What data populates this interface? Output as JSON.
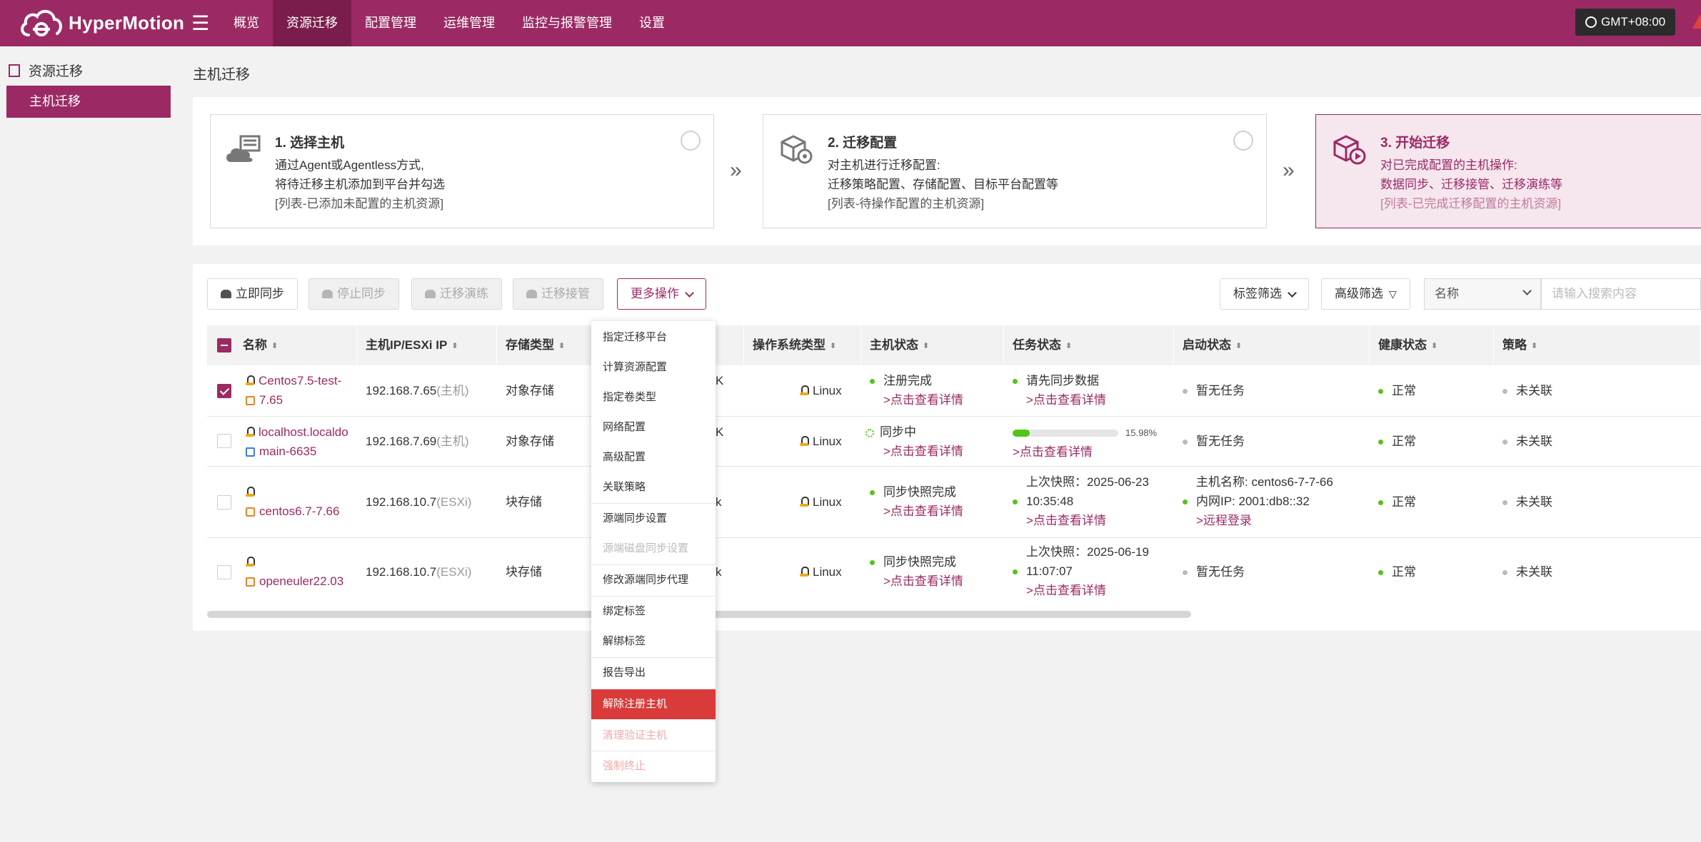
{
  "app": {
    "name": "HyperMotion"
  },
  "nav": [
    "概览",
    "资源迁移",
    "配置管理",
    "运维管理",
    "监控与报警管理",
    "设置"
  ],
  "timezone": "GMT+08:00",
  "sidebar": {
    "section": "资源迁移",
    "item": "主机迁移"
  },
  "page_title": "主机迁移",
  "steps": [
    {
      "title": "1. 选择主机",
      "lines": [
        "通过Agent或Agentless方式,",
        "将待迁移主机添加到平台并勾选",
        "[列表-已添加未配置的主机资源]"
      ]
    },
    {
      "title": "2. 迁移配置",
      "lines": [
        "对主机进行迁移配置:",
        "迁移策略配置、存储配置、目标平台配置等",
        "[列表-待操作配置的主机资源]"
      ]
    },
    {
      "title": "3. 开始迁移",
      "lines": [
        "对已完成配置的主机操作:",
        "数据同步、迁移接管、迁移演练等",
        "[列表-已完成迁移配置的主机资源]"
      ]
    }
  ],
  "toolbar": {
    "sync_now": "立即同步",
    "stop_sync": "停止同步",
    "drill": "迁移演练",
    "takeover": "迁移接管",
    "more": "更多操作",
    "tag_filter": "标签筛选",
    "adv_filter": "高级筛选",
    "search_field": "名称",
    "search_placeholder": "请输入搜索内容"
  },
  "table": {
    "headers": [
      "名称",
      "主机IP/ESXi IP",
      "存储类型",
      "操作系统类型",
      "主机状态",
      "任务状态",
      "启动状态",
      "健康状态",
      "策略"
    ],
    "rows": [
      {
        "checked": true,
        "name": [
          "Centos7.5-test-",
          "7.65"
        ],
        "ip": "192.168.7.65",
        "ip_tag": "(主机)",
        "storage": "对象存储",
        "fragment": "K",
        "os": "Linux",
        "host_status": "注册完成",
        "host_link": ">点击查看详情",
        "task": [
          "请先同步数据"
        ],
        "task_link": ">点击查看详情",
        "boot": [
          "暂无任务"
        ],
        "health": "正常",
        "policy": "未关联"
      },
      {
        "checked": false,
        "name": [
          "localhost.localdo",
          "main-6635"
        ],
        "ip": "192.168.7.69",
        "ip_tag": "(主机)",
        "storage": "对象存储",
        "fragment": "K",
        "os": "Linux",
        "host_status": "同步中",
        "host_link": ">点击查看详情",
        "task": [],
        "task_progress": 15.98,
        "task_progress_label": "15.98%",
        "task_link": ">点击查看详情",
        "boot": [
          "暂无任务"
        ],
        "health": "正常",
        "policy": "未关联"
      },
      {
        "checked": false,
        "name": [
          "centos6.7-7.66"
        ],
        "ip": "192.168.10.7",
        "ip_tag": "(ESXi)",
        "storage": "块存储",
        "fragment": "k",
        "os": "Linux",
        "host_status": "同步快照完成",
        "host_link": ">点击查看详情",
        "task": [
          "上次快照：2025-06-23",
          "10:35:48"
        ],
        "task_link": ">点击查看详情",
        "boot": [
          "主机名称: centos6-7-7-66",
          "内网IP: 2001:db8::32"
        ],
        "boot_link": ">远程登录",
        "health": "正常",
        "policy": "未关联"
      },
      {
        "checked": false,
        "name": [
          "openeuler22.03"
        ],
        "ip": "192.168.10.7",
        "ip_tag": "(ESXi)",
        "storage": "块存储",
        "fragment": "k",
        "os": "Linux",
        "host_status": "同步快照完成",
        "host_link": ">点击查看详情",
        "task": [
          "上次快照：2025-06-19",
          "11:07:07"
        ],
        "task_link": ">点击查看详情",
        "boot": [
          "暂无任务"
        ],
        "health": "正常",
        "policy": "未关联"
      }
    ]
  },
  "dropdown": [
    {
      "label": "指定迁移平台",
      "state": "normal"
    },
    {
      "label": "计算资源配置",
      "state": "normal"
    },
    {
      "label": "指定卷类型",
      "state": "normal"
    },
    {
      "label": "网络配置",
      "state": "normal"
    },
    {
      "label": "高级配置",
      "state": "normal"
    },
    {
      "label": "关联策略",
      "state": "normal"
    },
    {
      "label": "源端同步设置",
      "state": "normal"
    },
    {
      "label": "源端磁盘同步设置",
      "state": "disabled"
    },
    {
      "label": "修改源端同步代理",
      "state": "normal"
    },
    {
      "label": "绑定标签",
      "state": "normal"
    },
    {
      "label": "解绑标签",
      "state": "normal"
    },
    {
      "label": "报告导出",
      "state": "normal"
    },
    {
      "label": "解除注册主机",
      "state": "danger"
    },
    {
      "label": "清理验证主机",
      "state": "faintred"
    },
    {
      "label": "强制终止",
      "state": "faintred"
    }
  ],
  "colors": {
    "brand": "#9b2a64",
    "success": "#52c41a",
    "danger": "#d93a3a"
  }
}
